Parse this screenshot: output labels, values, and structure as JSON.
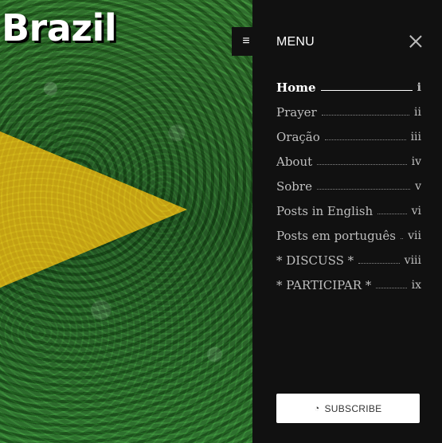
{
  "hero": {
    "title": "Brazil",
    "toggle_icon": "hamburger-icon"
  },
  "menu": {
    "header": "MENU",
    "close_icon": "close-icon",
    "items": [
      {
        "label": "Home",
        "num": "i",
        "active": true
      },
      {
        "label": "Prayer",
        "num": "ii",
        "active": false
      },
      {
        "label": "Oração",
        "num": "iii",
        "active": false
      },
      {
        "label": "About",
        "num": "iv",
        "active": false
      },
      {
        "label": "Sobre",
        "num": "v",
        "active": false
      },
      {
        "label": "Posts in English",
        "num": "vi",
        "active": false
      },
      {
        "label": "Posts em português",
        "num": "vii",
        "active": false
      },
      {
        "label": "* DISCUSS *",
        "num": "viii",
        "active": false
      },
      {
        "label": "* PARTICIPAR *",
        "num": "ix",
        "active": false
      }
    ],
    "subscribe_label": "SUBSCRIBE",
    "subscribe_icon": "rss-icon"
  }
}
